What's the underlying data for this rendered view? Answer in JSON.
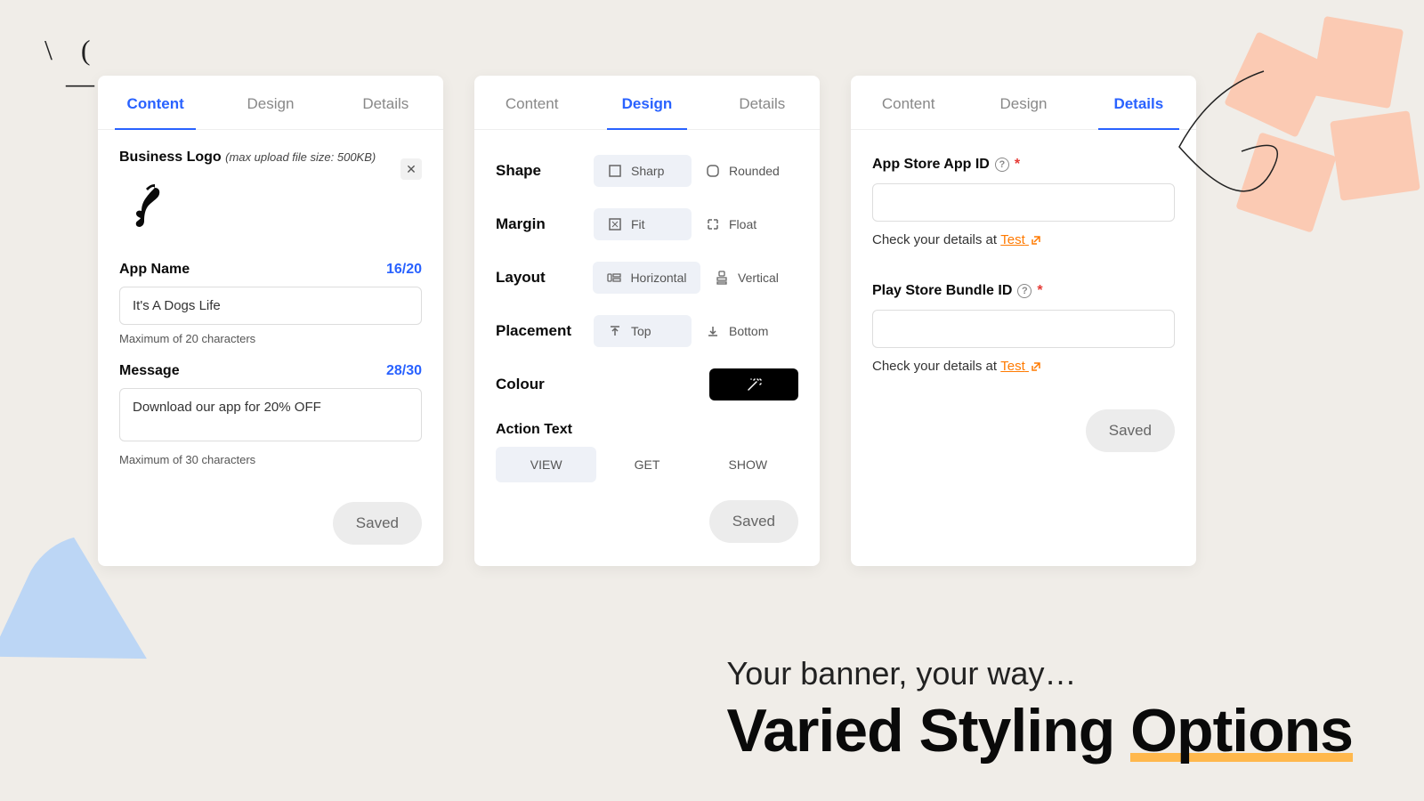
{
  "tabs": {
    "content": "Content",
    "design": "Design",
    "details": "Details"
  },
  "content": {
    "logo_label": "Business Logo",
    "logo_hint": "(max upload file size: 500KB)",
    "app_name_label": "App Name",
    "app_name_counter": "16/20",
    "app_name_value": "It's A Dogs Life",
    "app_name_help": "Maximum of 20 characters",
    "message_label": "Message",
    "message_counter": "28/30",
    "message_value": "Download our app for 20% OFF",
    "message_help": "Maximum of 30 characters",
    "saved": "Saved"
  },
  "design": {
    "shape_label": "Shape",
    "shape_sharp": "Sharp",
    "shape_rounded": "Rounded",
    "margin_label": "Margin",
    "margin_fit": "Fit",
    "margin_float": "Float",
    "layout_label": "Layout",
    "layout_h": "Horizontal",
    "layout_v": "Vertical",
    "placement_label": "Placement",
    "place_top": "Top",
    "place_bottom": "Bottom",
    "colour_label": "Colour",
    "action_text_label": "Action Text",
    "action_view": "VIEW",
    "action_get": "GET",
    "action_show": "SHOW",
    "saved": "Saved"
  },
  "details": {
    "app_store_label": "App Store App ID",
    "play_store_label": "Play Store Bundle ID",
    "check_text": "Check your details at ",
    "test_link": "Test",
    "saved": "Saved"
  },
  "hero": {
    "sub": "Your banner, your way…",
    "title_1": "Varied Styling ",
    "title_2": "Options"
  }
}
